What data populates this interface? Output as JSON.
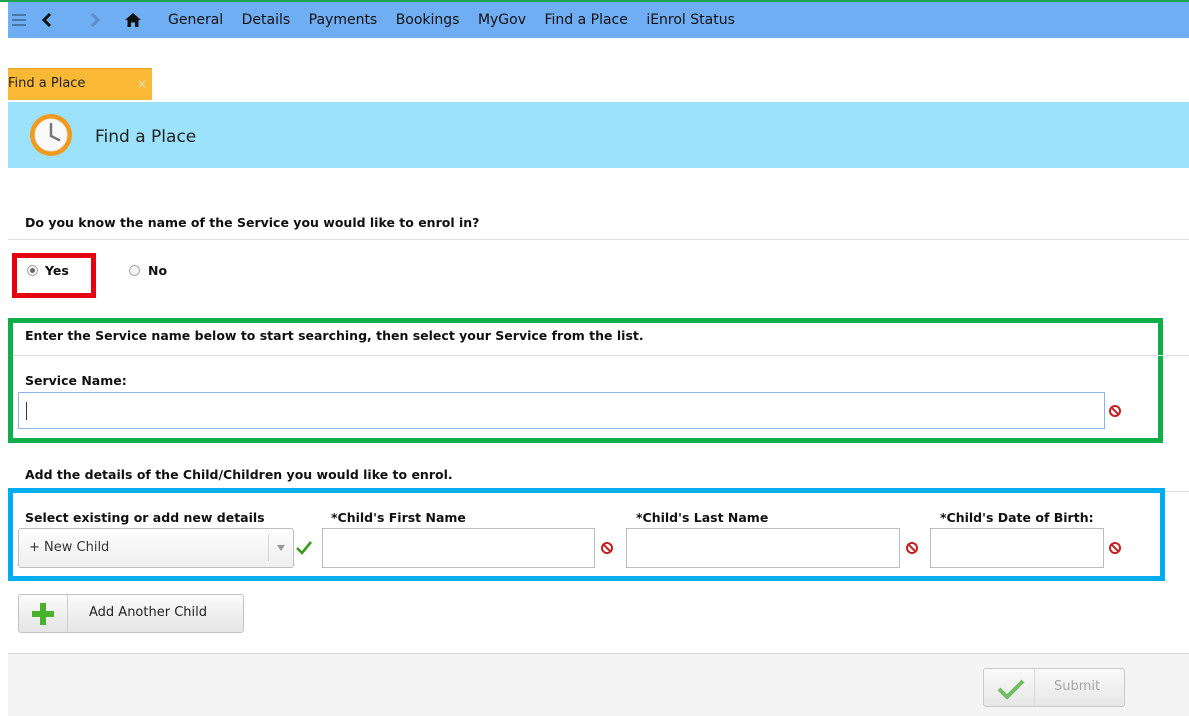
{
  "nav": {
    "links": [
      "General",
      "Details",
      "Payments",
      "Bookings",
      "MyGov",
      "Find a Place",
      "iEnrol Status"
    ]
  },
  "tab": {
    "label": "Find a Place",
    "close": "×"
  },
  "page": {
    "title": "Find a Place"
  },
  "question": {
    "text": "Do you know the name of the Service you would like to enrol in?",
    "yes_label": "Yes",
    "no_label": "No"
  },
  "service": {
    "instruction": "Enter the Service name below to start searching, then select your Service from the list.",
    "label": "Service Name:",
    "value": ""
  },
  "children": {
    "heading": "Add the details of the Child/Children you would like to enrol.",
    "select_label": "Select existing or add new details",
    "select_value": "+ New Child",
    "first_name_label": "*Child's First Name",
    "last_name_label": "*Child's Last Name",
    "dob_label": "*Child's Date of Birth:"
  },
  "actions": {
    "add_child": "Add Another Child",
    "submit": "Submit"
  },
  "colors": {
    "highlight_red": "#e60012",
    "highlight_green": "#0fae4b",
    "highlight_blue": "#00aeef"
  }
}
